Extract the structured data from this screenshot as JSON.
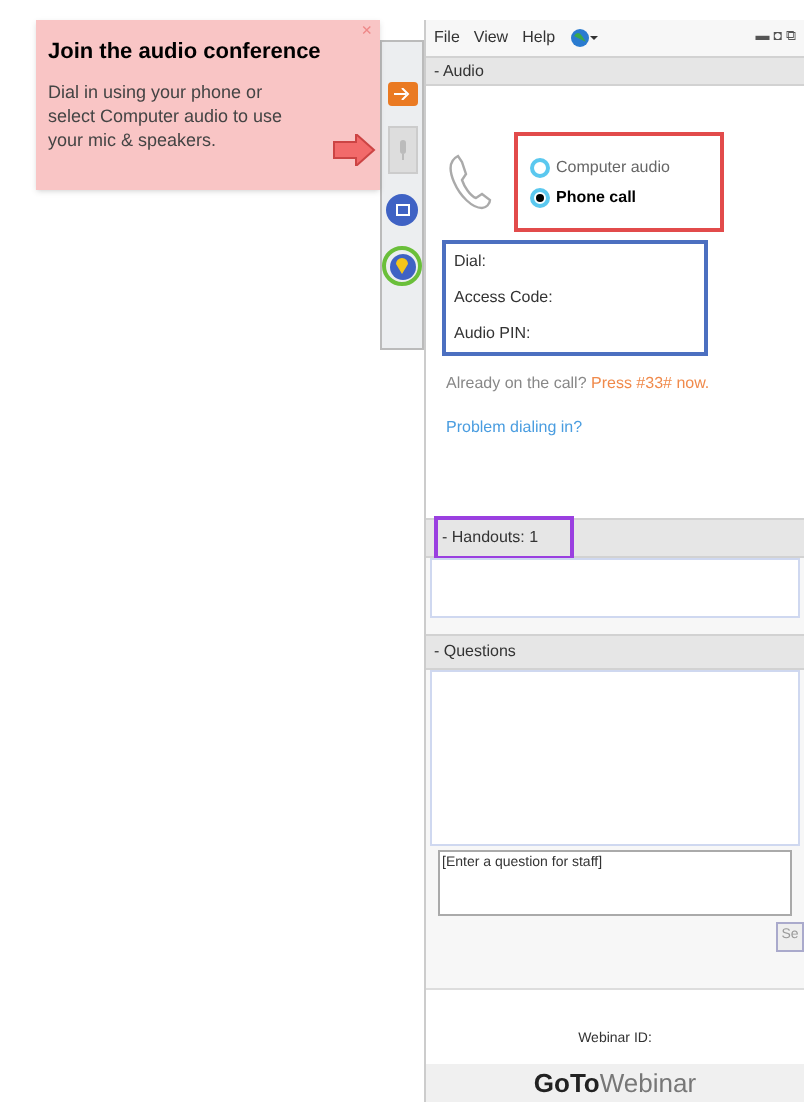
{
  "tooltip": {
    "title": "Join the audio conference",
    "body": "Dial in using your phone or select Computer audio to use your mic & speakers.",
    "close": "×"
  },
  "menu": [
    "File",
    "View",
    "Help"
  ],
  "window_controls": [
    "▬",
    "◘",
    "⧉"
  ],
  "audio": {
    "toggle": "-",
    "title": "Audio",
    "options": [
      {
        "label": "Computer audio",
        "selected": false
      },
      {
        "label": "Phone call",
        "selected": true
      }
    ],
    "details": [
      "Dial:",
      "Access Code:",
      "Audio PIN:"
    ],
    "already": "Already on the call?",
    "press": "Press #33# now.",
    "problem_link": "Problem dialing in?"
  },
  "handouts": {
    "toggle": "-",
    "title": "Handouts: 1"
  },
  "questions": {
    "toggle": "-",
    "title": "Questions",
    "placeholder": "[Enter a question for staff]",
    "send": "Se"
  },
  "webinar_id": "Webinar ID:",
  "brand": {
    "bold": "GoTo",
    "light": "Webinar"
  }
}
